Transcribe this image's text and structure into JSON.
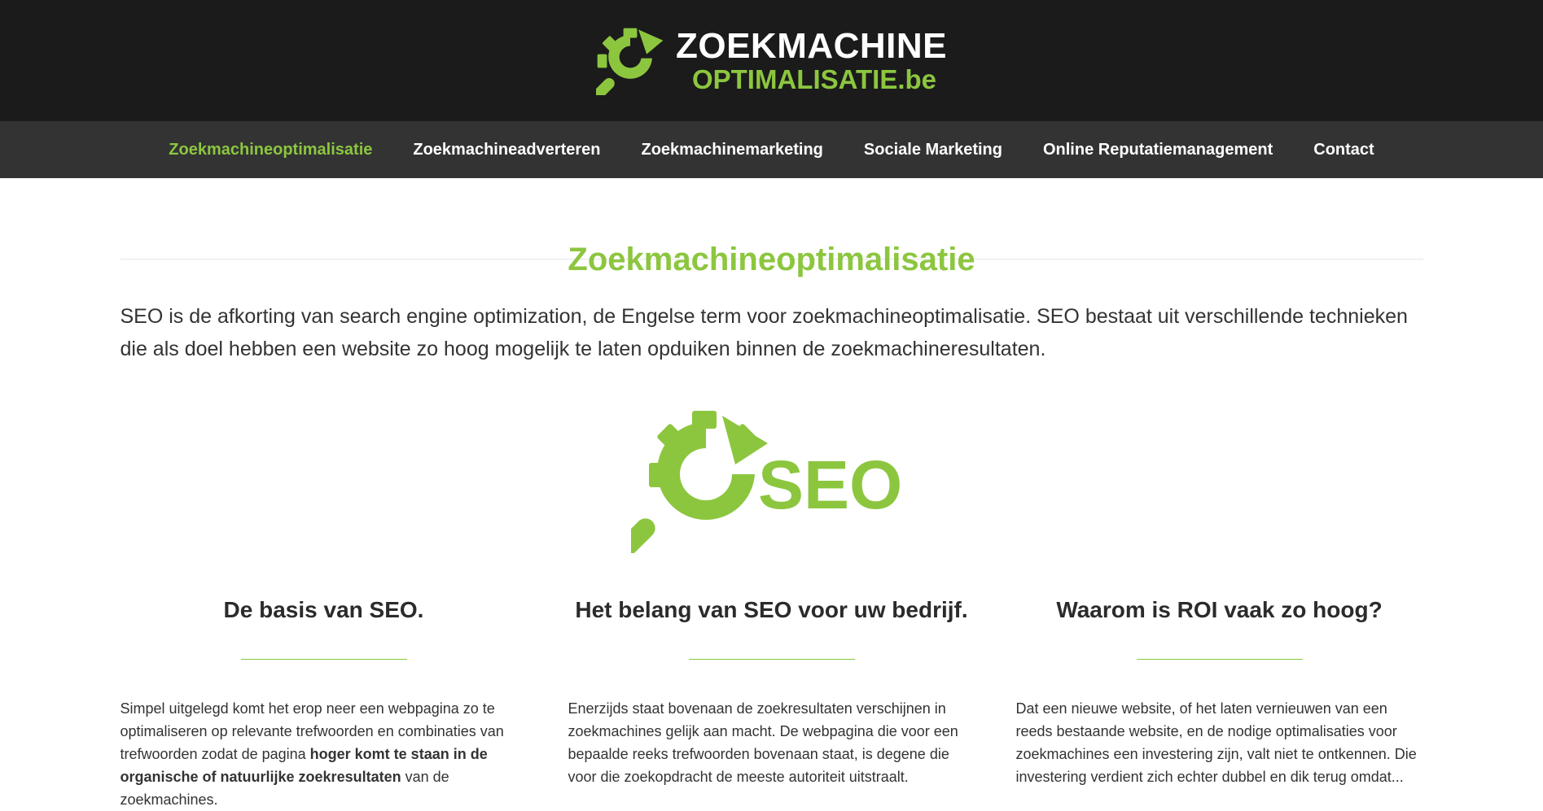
{
  "header": {
    "logo_line1": "ZOEKMACHINE",
    "logo_line2": "OPTIMALISATIE.be"
  },
  "nav": {
    "items": [
      {
        "label": "Zoekmachineoptimalisatie",
        "active": true
      },
      {
        "label": "Zoekmachineadverteren",
        "active": false
      },
      {
        "label": "Zoekmachinemarketing",
        "active": false
      },
      {
        "label": "Sociale Marketing",
        "active": false
      },
      {
        "label": "Online Reputatiemanagement",
        "active": false
      },
      {
        "label": "Contact",
        "active": false
      }
    ]
  },
  "main": {
    "title": "Zoekmachineoptimalisatie",
    "intro": "SEO is de afkorting van search engine optimization, de Engelse term voor zoekmachineoptimalisatie. SEO bestaat uit verschillende technieken die als doel hebben een website zo hoog mogelijk te laten opduiken binnen de zoekmachineresultaten.",
    "seo_logo_text": "SEO",
    "columns": [
      {
        "heading": "De basis van SEO.",
        "text_before": "Simpel uitgelegd komt het erop neer een webpagina zo te optimaliseren op relevante trefwoorden en combinaties van trefwoorden zodat de pagina ",
        "text_bold": "hoger komt te staan in de organische of natuurlijke zoekresultaten",
        "text_after": " van de zoekmachines."
      },
      {
        "heading": "Het belang van SEO voor uw bedrijf.",
        "text": "Enerzijds staat bovenaan de zoekresultaten verschijnen in zoekmachines gelijk aan macht. De webpagina die voor een bepaalde reeks trefwoorden bovenaan staat, is degene die voor die zoekopdracht de meeste autoriteit uitstraalt."
      },
      {
        "heading": "Waarom is ROI vaak zo hoog?",
        "text": "Dat een nieuwe website, of het laten vernieuwen van een reeds bestaande website, en de nodige optimalisaties voor zoekmachines een investering zijn, valt niet te ontkennen. Die investering verdient zich echter dubbel en dik terug omdat..."
      }
    ]
  },
  "colors": {
    "brand_green": "#8cc63f",
    "header_bg": "#1b1b1b",
    "nav_bg": "#333333",
    "text": "#333333"
  },
  "icons": [
    "magnifier-gear-logo-icon",
    "seo-gear-magnifier-icon"
  ]
}
